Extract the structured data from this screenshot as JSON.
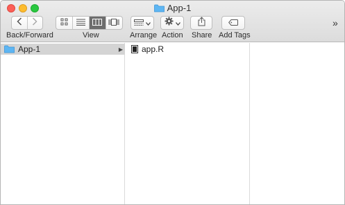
{
  "window": {
    "title": "App-1"
  },
  "toolbar": {
    "back_forward_label": "Back/Forward",
    "view_label": "View",
    "arrange_label": "Arrange",
    "action_label": "Action",
    "share_label": "Share",
    "add_tags_label": "Add Tags",
    "overflow_label": "»"
  },
  "columns": [
    {
      "items": [
        {
          "name": "App-1",
          "kind": "folder",
          "selected": true
        }
      ]
    },
    {
      "items": [
        {
          "name": "app.R",
          "kind": "file",
          "selected": false
        }
      ]
    },
    {
      "items": []
    }
  ],
  "colors": {
    "close": "#fc5f57",
    "minimize": "#fdbc2e",
    "zoom": "#29c840",
    "folder": "#5eb6f3",
    "selection": "#d4d4d4"
  }
}
